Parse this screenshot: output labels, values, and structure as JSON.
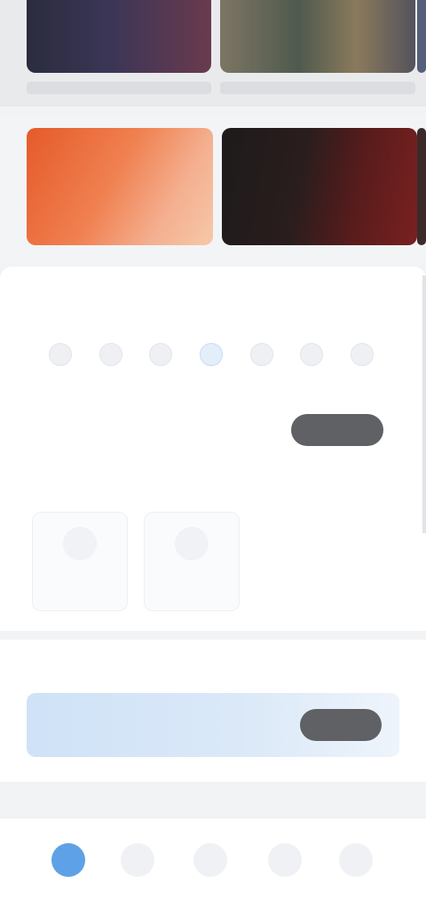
{
  "banners": [
    {
      "text": ""
    },
    {
      "text": ""
    }
  ],
  "checkin": {
    "title": "",
    "days": [
      {
        "name": "",
        "value": ""
      },
      {
        "name": "",
        "value": ""
      },
      {
        "name": "",
        "value": ""
      },
      {
        "name": "",
        "value": ""
      },
      {
        "name": "",
        "value": ""
      },
      {
        "name": "",
        "value": ""
      },
      {
        "name": "",
        "value": ""
      }
    ],
    "active_day_index": 3,
    "status_text": "",
    "button_label": ""
  },
  "tasks": {
    "title": "",
    "items": [
      {
        "name": "",
        "reward": ""
      },
      {
        "name": "",
        "reward": ""
      }
    ]
  },
  "member": {
    "brand": "",
    "subtitle": "",
    "promo": "",
    "button_label": ""
  },
  "bottom_nav": {
    "active_index": 0,
    "items": [
      {
        "label": ""
      },
      {
        "label": ""
      },
      {
        "label": ""
      },
      {
        "label": ""
      },
      {
        "label": ""
      }
    ]
  },
  "colors": {
    "accent": "#5ea1e6",
    "button_dark": "#5f6164",
    "banner_orange": "#e55a2a",
    "banner_dark": "#5a1c1c"
  }
}
